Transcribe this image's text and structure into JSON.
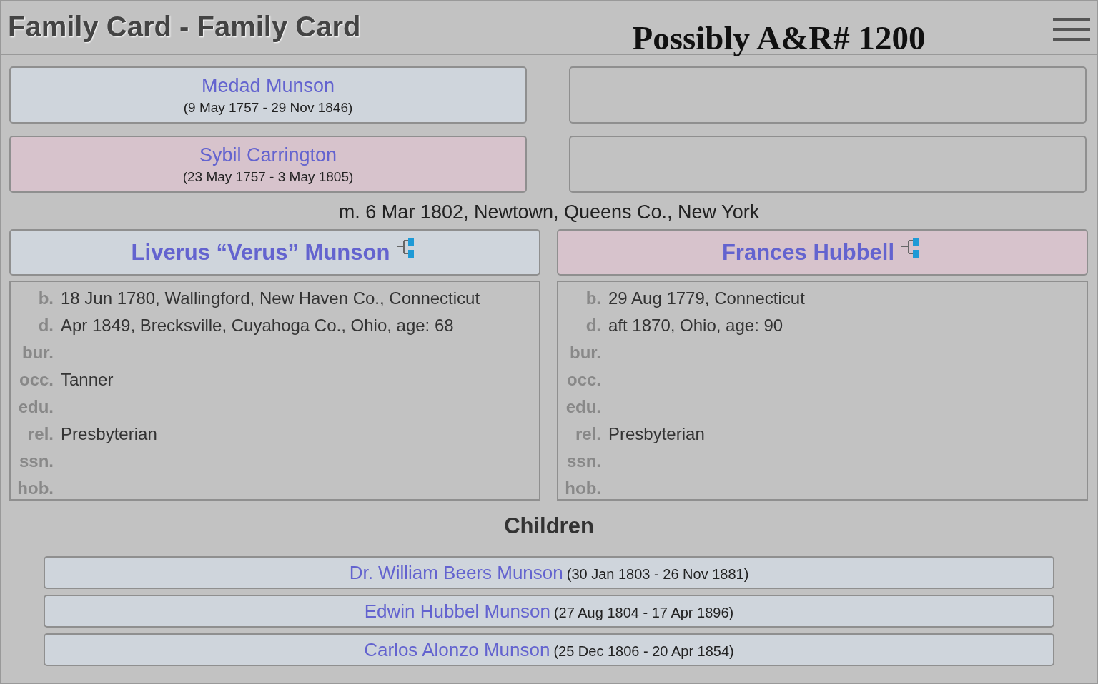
{
  "header": {
    "title": "Family Card - Family Card",
    "subtitle": "Possibly A&R# 1200"
  },
  "parents": [
    {
      "name": "Medad Munson",
      "dates": "(9 May 1757 - 29 Nov 1846)",
      "color": "#cfd5dc"
    },
    {
      "name": "Sybil Carrington",
      "dates": "(23 May 1757 - 3 May 1805)",
      "color": "#d7c3cc"
    }
  ],
  "marriage": "m. 6 Mar 1802, Newtown, Queens Co., New York",
  "spouses": [
    {
      "name": "Liverus “Verus” Munson",
      "color": "#cfd5dc",
      "facts": [
        {
          "label": "b.",
          "value": "18 Jun 1780, Wallingford, New Haven Co., Connecticut"
        },
        {
          "label": "d.",
          "value": "Apr 1849, Brecksville, Cuyahoga Co., Ohio, age: 68"
        },
        {
          "label": "bur."
        },
        {
          "label": "occ.",
          "value": "Tanner"
        },
        {
          "label": "edu."
        },
        {
          "label": "rel.",
          "value": "Presbyterian"
        },
        {
          "label": "ssn."
        },
        {
          "label": "hob."
        }
      ]
    },
    {
      "name": "Frances Hubbell",
      "color": "#d7c3cc",
      "facts": [
        {
          "label": "b.",
          "value": "29 Aug 1779, Connecticut"
        },
        {
          "label": "d.",
          "value": "aft 1870, Ohio, age: 90"
        },
        {
          "label": "bur."
        },
        {
          "label": "occ."
        },
        {
          "label": "edu."
        },
        {
          "label": "rel.",
          "value": "Presbyterian"
        },
        {
          "label": "ssn."
        },
        {
          "label": "hob."
        }
      ]
    }
  ],
  "children_heading": "Children",
  "children": [
    {
      "name": "Dr. William Beers Munson",
      "dates": "(30 Jan 1803 - 26 Nov 1881)",
      "color": "#cfd5dc"
    },
    {
      "name": "Edwin Hubbel Munson",
      "dates": "(27 Aug 1804 - 17 Apr 1896)",
      "color": "#cfd5dc"
    },
    {
      "name": "Carlos Alonzo Munson",
      "dates": "(25 Dec 1806 - 20 Apr 1854)",
      "color": "#cfd5dc"
    }
  ]
}
